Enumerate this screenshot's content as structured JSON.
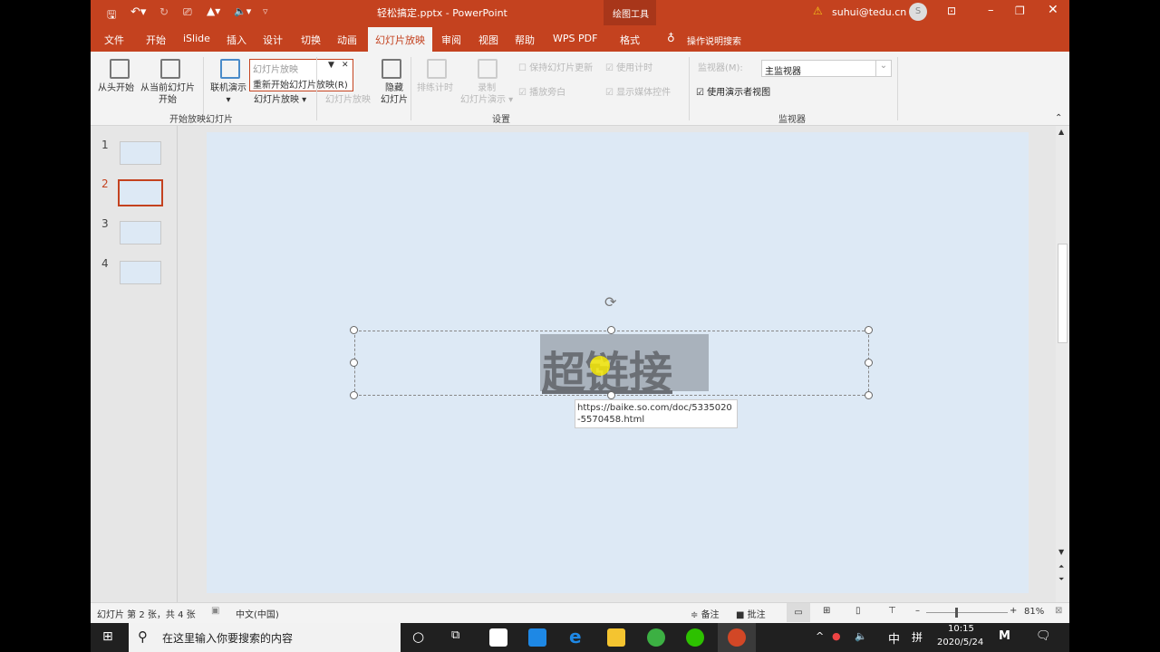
{
  "titlebar": {
    "filename": "轻松搞定.pptx",
    "separator": "-",
    "app": "PowerPoint",
    "context_tool": "绘图工具",
    "user": "suhui@tedu.cn",
    "avatar_letter": "S"
  },
  "tabs": [
    "文件",
    "开始",
    "iSlide",
    "插入",
    "设计",
    "切换",
    "动画",
    "幻灯片放映",
    "审阅",
    "视图",
    "帮助",
    "WPS PDF",
    "格式"
  ],
  "active_tab": "幻灯片放映",
  "tell_me": "操作说明搜索",
  "ribbon": {
    "from_beginning": "从头开始",
    "from_current_l1": "从当前幻灯片",
    "from_current_l2": "开始",
    "online": "联机演示",
    "custom": "幻灯片放映",
    "group_start": "开始放映幻灯片",
    "tooltip_title": "幻灯片放映",
    "tooltip_item": "重新开始幻灯片放映(R)",
    "setup": "幻灯片放映",
    "hide_l1": "隐藏",
    "hide_l2": "幻灯片",
    "rehearse": "排练计时",
    "record_l1": "录制",
    "record_l2": "幻灯片演示",
    "keep_updated": "保持幻灯片更新",
    "use_timings": "使用计时",
    "play_narration": "播放旁白",
    "show_media": "显示媒体控件",
    "group_setup": "设置",
    "monitor_label": "监视器(M):",
    "monitor_value": "主监视器",
    "presenter_view": "使用演示者视图",
    "group_monitor": "监视器"
  },
  "thumbnails": [
    "1",
    "2",
    "3",
    "4"
  ],
  "selected_slide": 2,
  "slide": {
    "text": "超链接",
    "tooltip": "https://baike.so.com/doc/5335020-5570458.html"
  },
  "status": {
    "slide_info": "幻灯片 第 2 张，共 4 张",
    "language": "中文(中国)",
    "notes": "备注",
    "comments": "批注",
    "zoom": "81%"
  },
  "taskbar": {
    "search_placeholder": "在这里输入你要搜索的内容",
    "ime": "中",
    "ime2": "拼",
    "time": "10:15",
    "date": "2020/5/24"
  },
  "colors": {
    "accent": "#c4421f",
    "slide_bg": "#dde9f5"
  }
}
